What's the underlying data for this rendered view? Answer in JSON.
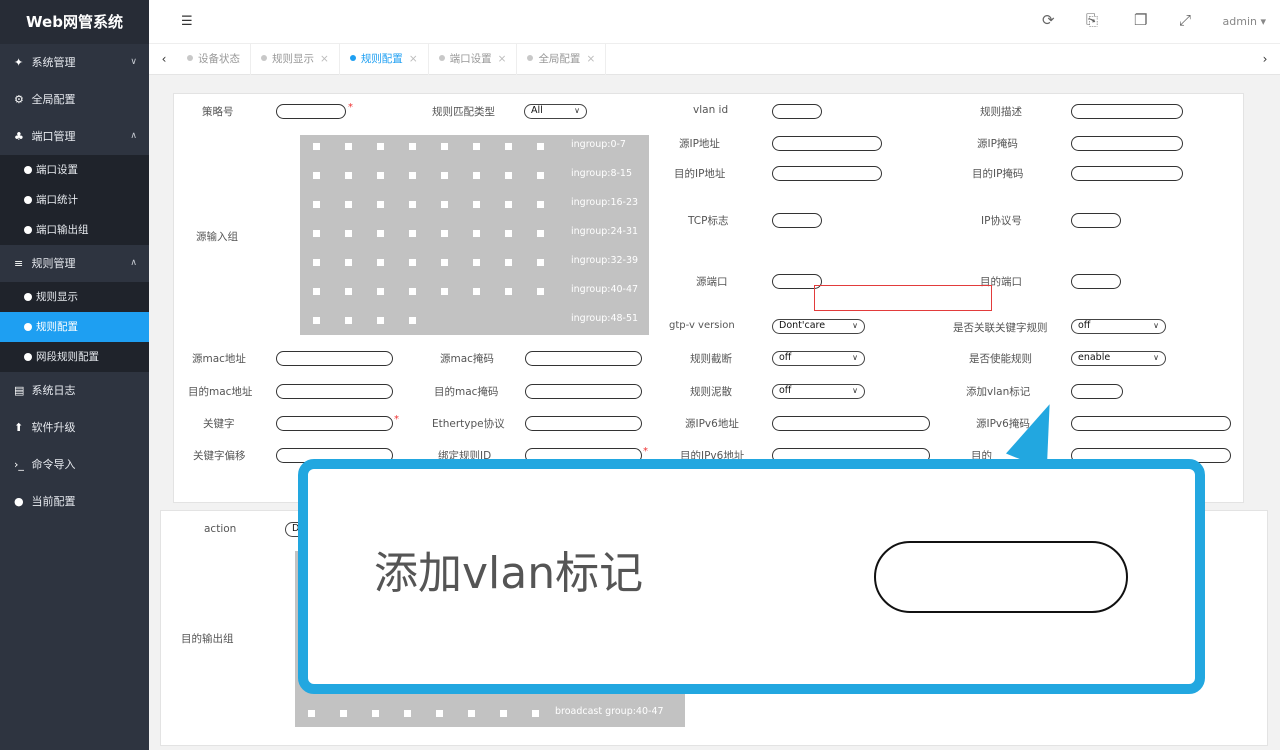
{
  "app": {
    "title": "Web网管系统",
    "user": "admin ▾"
  },
  "icons": {
    "menu": "menu-fold-icon",
    "refresh": "refresh-icon",
    "save": "save-icon",
    "copy": "copy-icon",
    "fullscreen": "fullscreen-icon"
  },
  "sidebar": {
    "items": [
      {
        "label": "系统管理",
        "icon": "home-icon",
        "glyph": "✦",
        "caret": "∨"
      },
      {
        "label": "全局配置",
        "icon": "gears-icon",
        "glyph": "⚙",
        "caret": ""
      },
      {
        "label": "端口管理",
        "icon": "sitemap-icon",
        "glyph": "♣",
        "caret": "∧"
      },
      {
        "label": "规则管理",
        "icon": "sliders-icon",
        "glyph": "≡",
        "caret": "∧"
      },
      {
        "label": "系统日志",
        "icon": "file-icon",
        "glyph": "▤",
        "caret": ""
      },
      {
        "label": "软件升级",
        "icon": "upload-icon",
        "glyph": "⬆",
        "caret": ""
      },
      {
        "label": "命令导入",
        "icon": "terminal-icon",
        "glyph": "›_",
        "caret": ""
      },
      {
        "label": "当前配置",
        "icon": "map-marker-icon",
        "glyph": "●",
        "caret": ""
      }
    ],
    "port_sub": [
      "端口设置",
      "端口统计",
      "端口输出组"
    ],
    "rule_sub": [
      "规则显示",
      "规则配置",
      "网段规则配置"
    ]
  },
  "tabs": [
    {
      "label": "设备状态",
      "close": ""
    },
    {
      "label": "规则显示",
      "close": "×"
    },
    {
      "label": "规则配置",
      "close": "×"
    },
    {
      "label": "端口设置",
      "close": "×"
    },
    {
      "label": "全局配置",
      "close": "×"
    }
  ],
  "form": {
    "policy_no": "策略号",
    "rule_match_type": "规则匹配类型",
    "rule_match_value": "All",
    "vlan_id": "vlan id",
    "rule_desc": "规则描述",
    "src_ip": "源IP地址",
    "src_ip_mask": "源IP掩码",
    "dst_ip": "目的IP地址",
    "dst_ip_mask": "目的IP掩码",
    "tcp_flag": "TCP标志",
    "ip_proto": "IP协议号",
    "src_port": "源端口",
    "dst_port": "目的端口",
    "src_input_group": "源输入组",
    "ingroups": [
      "ingroup:0-7",
      "ingroup:8-15",
      "ingroup:16-23",
      "ingroup:24-31",
      "ingroup:32-39",
      "ingroup:40-47",
      "ingroup:48-51"
    ],
    "gtp_version": "gtp-v version",
    "gtp_value": "Dont'care",
    "link_keyword": "是否关联关键字规则",
    "link_keyword_value": "off",
    "src_mac": "源mac地址",
    "src_mac_mask": "源mac掩码",
    "rule_truncate": "规则截断",
    "rule_truncate_value": "off",
    "enable_rule": "是否使能规则",
    "enable_rule_value": "enable",
    "dst_mac": "目的mac地址",
    "dst_mac_mask": "目的mac掩码",
    "rule_scatter": "规则泥散",
    "rule_scatter_value": "off",
    "add_vlan_tag": "添加vlan标记",
    "keyword": "关键字",
    "ethertype": "Ethertype协议",
    "src_ipv6": "源IPv6地址",
    "src_ipv6_mask": "源IPv6掩码",
    "keyword_offset": "关键字偏移",
    "bind_rule_id": "绑定规则ID",
    "dst_ipv6": "目的IPv6地址",
    "dst_ipv6_mask": "目的",
    "action": "action",
    "action_value": "D",
    "dst_output_group": "目的输出组",
    "broadcast_group": "broadcast group:40-47",
    "required": "*"
  },
  "zoom": {
    "label": "添加vlan标记"
  }
}
